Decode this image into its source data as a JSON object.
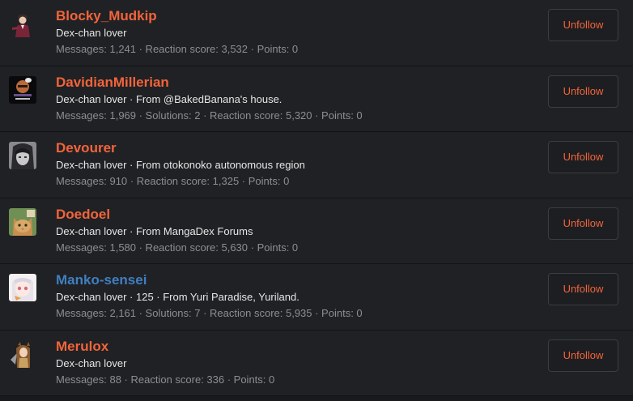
{
  "colors": {
    "accent": "#f2643b",
    "staff_name": "#3f7fc2",
    "button_text": "#f2643b"
  },
  "members": [
    {
      "name": "Blocky_Mudkip",
      "name_color": "#f2643b",
      "title": "Dex-chan lover",
      "stats": "Messages: 1,241 · Reaction score: 3,532 · Points: 0",
      "button": "Unfollow",
      "avatar_icon": "avatar-suited-man-icon"
    },
    {
      "name": "DavidianMillerian",
      "name_color": "#f2643b",
      "title": "Dex-chan lover · From @BakedBanana's house.",
      "stats": "Messages: 1,969 · Solutions: 2 · Reaction score: 5,320 · Points: 0",
      "button": "Unfollow",
      "avatar_icon": "avatar-thought-bubble-icon"
    },
    {
      "name": "Devourer",
      "name_color": "#f2643b",
      "title": "Dex-chan lover · From otokonoko autonomous region",
      "stats": "Messages: 910 · Reaction score: 1,325 · Points: 0",
      "button": "Unfollow",
      "avatar_icon": "avatar-monochrome-manga-icon"
    },
    {
      "name": "Doedoel",
      "name_color": "#f2643b",
      "title": "Dex-chan lover · From MangaDex Forums",
      "stats": "Messages: 1,580 · Reaction score: 5,630 · Points: 0",
      "button": "Unfollow",
      "avatar_icon": "avatar-cat-icon"
    },
    {
      "name": "Manko-sensei",
      "name_color": "#3f7fc2",
      "title": "Dex-chan lover · 125 · From Yuri Paradise, Yuriland.",
      "stats": "Messages: 2,161 · Solutions: 7 · Reaction score: 5,935 · Points: 0",
      "button": "Unfollow",
      "avatar_icon": "avatar-anime-girl-icon"
    },
    {
      "name": "Merulox",
      "name_color": "#f2643b",
      "title": "Dex-chan lover",
      "stats": "Messages: 88 · Reaction score: 336 · Points: 0",
      "button": "Unfollow",
      "avatar_icon": "avatar-wolf-girl-icon"
    }
  ]
}
